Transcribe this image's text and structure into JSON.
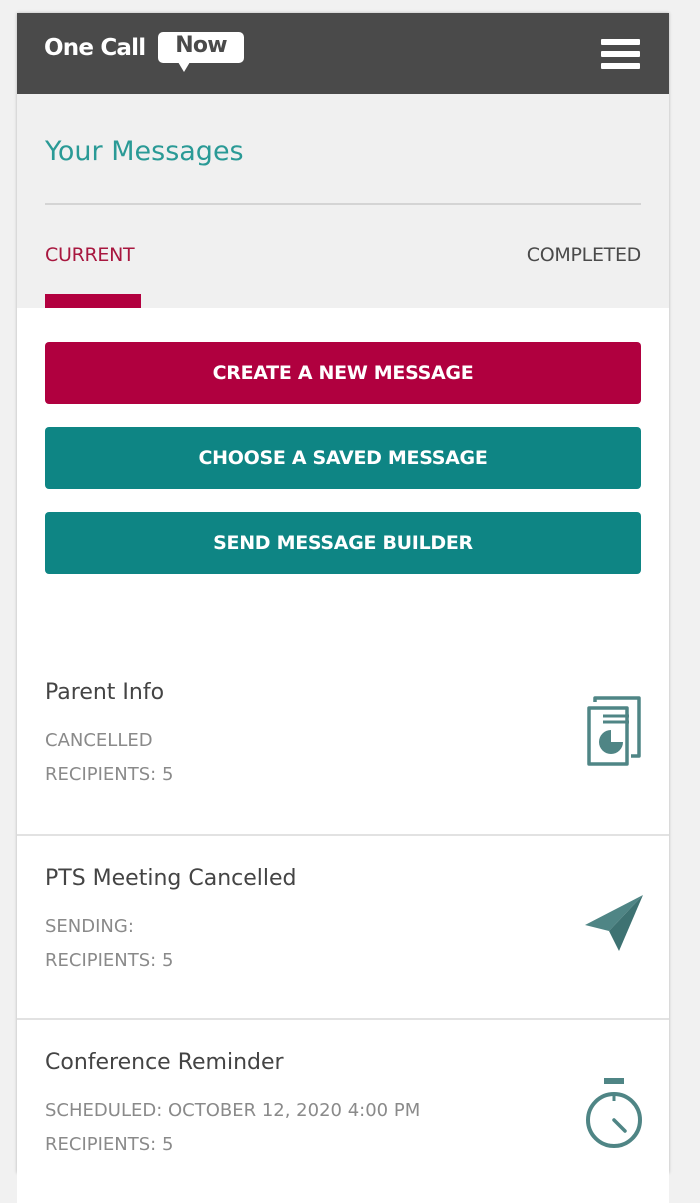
{
  "header": {
    "logo_text": "One Call",
    "logo_bubble": "Now",
    "menu_icon": "hamburger-menu-icon"
  },
  "page": {
    "title": "Your Messages"
  },
  "tabs": [
    {
      "label": "CURRENT",
      "active": true
    },
    {
      "label": "COMPLETED",
      "active": false
    }
  ],
  "actions": {
    "create": "CREATE A NEW MESSAGE",
    "choose_saved": "CHOOSE A SAVED MESSAGE",
    "builder": "SEND MESSAGE BUILDER"
  },
  "messages": [
    {
      "title": "Parent Info",
      "status": "CANCELLED",
      "recipients": "RECIPIENTS: 5",
      "icon": "report-document-icon"
    },
    {
      "title": "PTS Meeting Cancelled",
      "status": "SENDING:",
      "recipients": "RECIPIENTS: 5",
      "icon": "paper-plane-icon"
    },
    {
      "title": "Conference Reminder",
      "status": "SCHEDULED: OCTOBER 12, 2020 4:00 PM",
      "recipients": "RECIPIENTS: 5",
      "icon": "stopwatch-icon"
    }
  ],
  "colors": {
    "header_bg": "#4a4a4a",
    "title_teal": "#2a9a96",
    "primary_red": "#b0003f",
    "button_teal": "#0e8584",
    "icon_teal": "#4f8585",
    "muted_text": "#8a8a8a"
  }
}
